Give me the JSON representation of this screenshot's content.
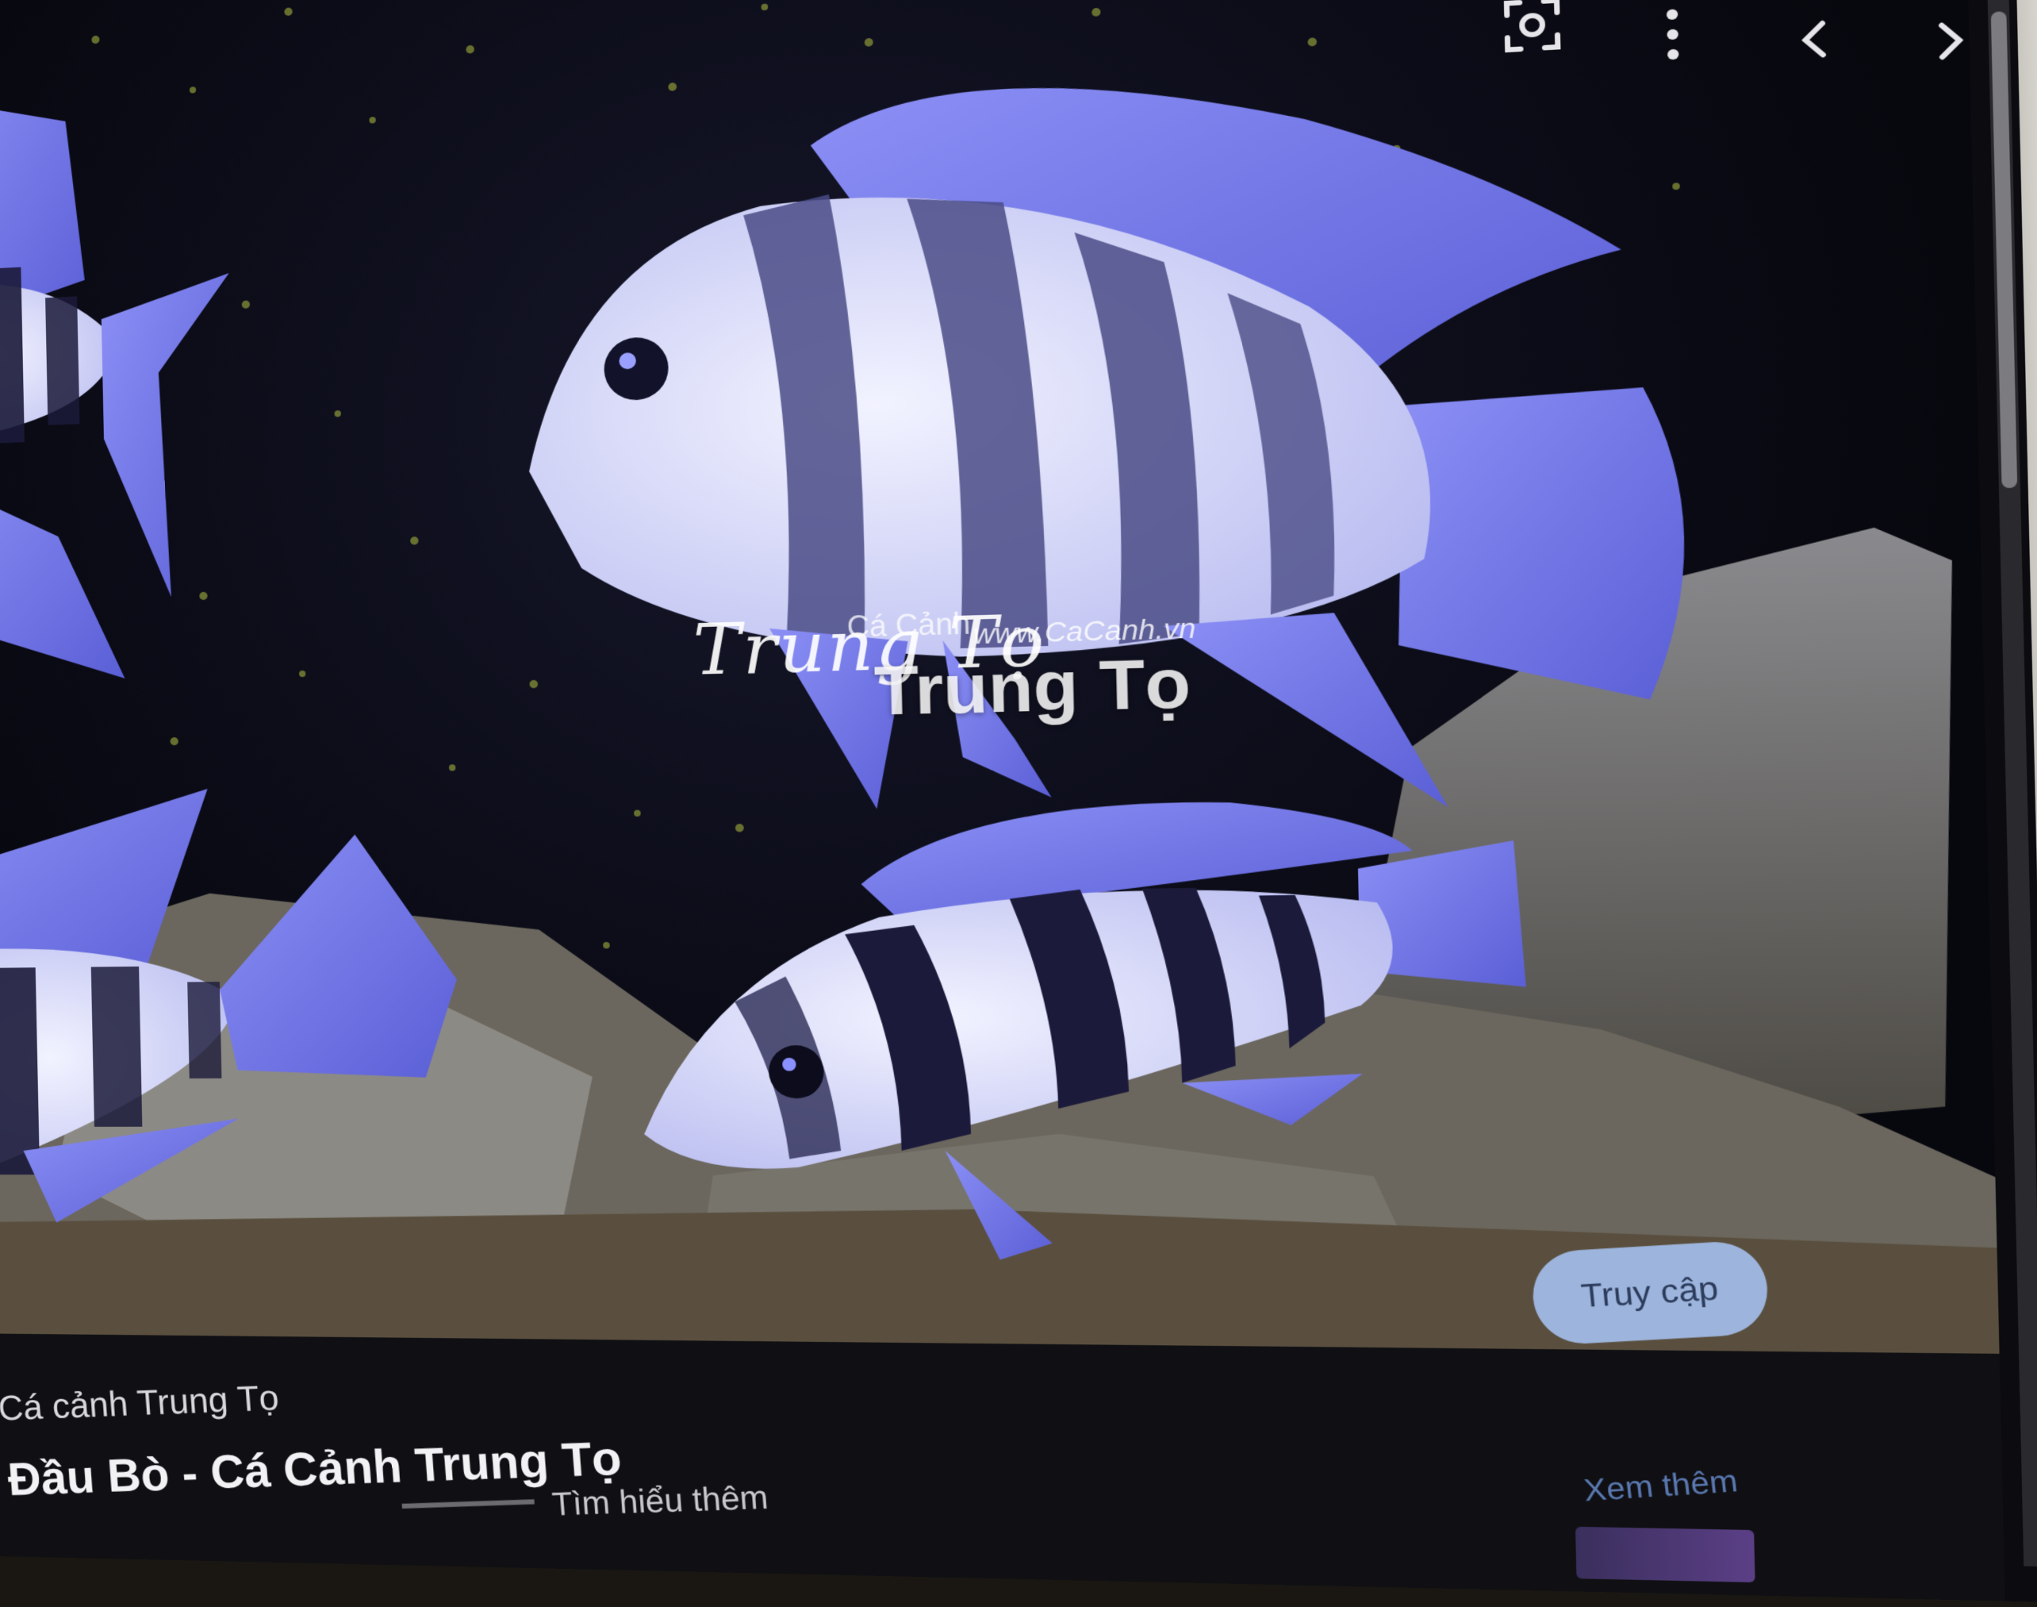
{
  "viewer": {
    "toolbar": {
      "lens_icon": "google-lens-icon",
      "more_icon": "more-vertical-icon",
      "prev_icon": "chevron-left-icon",
      "next_icon": "chevron-right-icon"
    },
    "image_watermark": {
      "handwritten": "Trung Tọ",
      "small": "Cá Cảnh",
      "site": "www.CaCanh.vn",
      "big": "Trung Tọ"
    },
    "visit_button": "Truy cập"
  },
  "result": {
    "source_name": "Cá cảnh Trung Tọ",
    "title": "Đầu Bò - Cá Cảnh Trung Tọ",
    "learn_more": "Tìm hiểu thêm",
    "see_more": "Xem thêm"
  },
  "colors": {
    "fish_blue": "#6f74e8",
    "fish_white": "#e9ebff",
    "stripe_dark": "#1b1a3a",
    "button_bg": "#9db4dc",
    "link_blue": "#5a78b0"
  }
}
